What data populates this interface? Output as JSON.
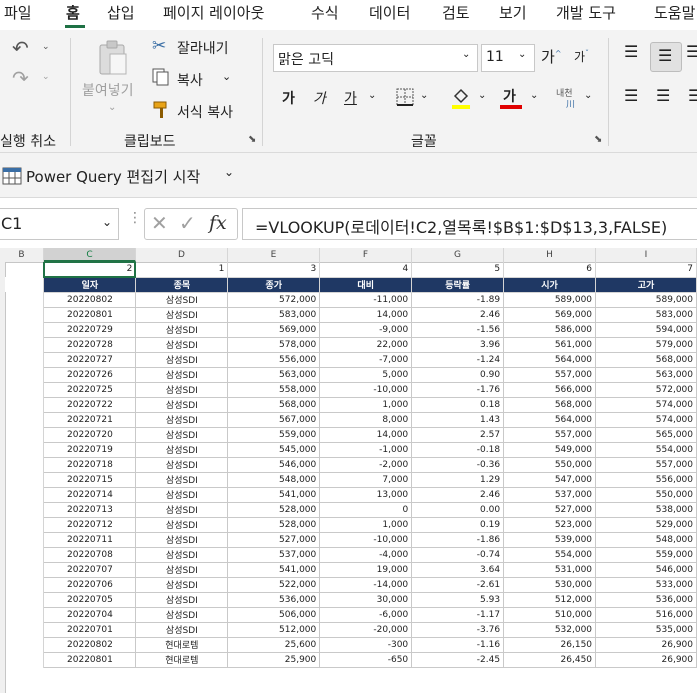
{
  "menu": [
    "파일",
    "홈",
    "삽입",
    "페이지 레이아웃",
    "수식",
    "데이터",
    "검토",
    "보기",
    "개발 도구",
    "도움말"
  ],
  "ribbon": {
    "undo_label": "실행 취소",
    "paste_label": "붙여넣기",
    "cut_label": "잘라내기",
    "copy_label": "복사",
    "format_painter_label": "서식 복사",
    "clipboard_label": "클립보드",
    "font_name": "맑은 고딕",
    "font_size": "11",
    "bold": "가",
    "italic": "가",
    "underline": "가",
    "font_color_glyph": "가",
    "phonetic": "내천",
    "font_label": "글꼴",
    "font_color": "#e00000",
    "fill_color": "#ffff00"
  },
  "querybar": {
    "label": "Power Query 편집기 시작"
  },
  "formulabar": {
    "namebox": "C1",
    "fx": "fx",
    "formula": "=VLOOKUP(로데이터!C2,열목록!$B$1:$D$13,3,FALSE)"
  },
  "sheet": {
    "columns": [
      "B",
      "C",
      "D",
      "E",
      "F",
      "G",
      "H",
      "I"
    ],
    "selected_column": "C",
    "row1": [
      "",
      "2",
      "1",
      "3",
      "4",
      "5",
      "6",
      "7"
    ],
    "headers": [
      "일자",
      "종목",
      "종가",
      "대비",
      "등락률",
      "시가",
      "고가"
    ],
    "rows": [
      [
        "20220802",
        "삼성SDI",
        "572,000",
        "-11,000",
        "-1.89",
        "589,000",
        "589,000"
      ],
      [
        "20220801",
        "삼성SDI",
        "583,000",
        "14,000",
        "2.46",
        "569,000",
        "583,000"
      ],
      [
        "20220729",
        "삼성SDI",
        "569,000",
        "-9,000",
        "-1.56",
        "586,000",
        "594,000"
      ],
      [
        "20220728",
        "삼성SDI",
        "578,000",
        "22,000",
        "3.96",
        "561,000",
        "579,000"
      ],
      [
        "20220727",
        "삼성SDI",
        "556,000",
        "-7,000",
        "-1.24",
        "564,000",
        "568,000"
      ],
      [
        "20220726",
        "삼성SDI",
        "563,000",
        "5,000",
        "0.90",
        "557,000",
        "563,000"
      ],
      [
        "20220725",
        "삼성SDI",
        "558,000",
        "-10,000",
        "-1.76",
        "566,000",
        "572,000"
      ],
      [
        "20220722",
        "삼성SDI",
        "568,000",
        "1,000",
        "0.18",
        "568,000",
        "574,000"
      ],
      [
        "20220721",
        "삼성SDI",
        "567,000",
        "8,000",
        "1.43",
        "564,000",
        "574,000"
      ],
      [
        "20220720",
        "삼성SDI",
        "559,000",
        "14,000",
        "2.57",
        "557,000",
        "565,000"
      ],
      [
        "20220719",
        "삼성SDI",
        "545,000",
        "-1,000",
        "-0.18",
        "549,000",
        "554,000"
      ],
      [
        "20220718",
        "삼성SDI",
        "546,000",
        "-2,000",
        "-0.36",
        "550,000",
        "557,000"
      ],
      [
        "20220715",
        "삼성SDI",
        "548,000",
        "7,000",
        "1.29",
        "547,000",
        "556,000"
      ],
      [
        "20220714",
        "삼성SDI",
        "541,000",
        "13,000",
        "2.46",
        "537,000",
        "550,000"
      ],
      [
        "20220713",
        "삼성SDI",
        "528,000",
        "0",
        "0.00",
        "527,000",
        "538,000"
      ],
      [
        "20220712",
        "삼성SDI",
        "528,000",
        "1,000",
        "0.19",
        "523,000",
        "529,000"
      ],
      [
        "20220711",
        "삼성SDI",
        "527,000",
        "-10,000",
        "-1.86",
        "539,000",
        "548,000"
      ],
      [
        "20220708",
        "삼성SDI",
        "537,000",
        "-4,000",
        "-0.74",
        "554,000",
        "559,000"
      ],
      [
        "20220707",
        "삼성SDI",
        "541,000",
        "19,000",
        "3.64",
        "531,000",
        "546,000"
      ],
      [
        "20220706",
        "삼성SDI",
        "522,000",
        "-14,000",
        "-2.61",
        "530,000",
        "533,000"
      ],
      [
        "20220705",
        "삼성SDI",
        "536,000",
        "30,000",
        "5.93",
        "512,000",
        "536,000"
      ],
      [
        "20220704",
        "삼성SDI",
        "506,000",
        "-6,000",
        "-1.17",
        "510,000",
        "516,000"
      ],
      [
        "20220701",
        "삼성SDI",
        "512,000",
        "-20,000",
        "-3.76",
        "532,000",
        "535,000"
      ],
      [
        "20220802",
        "현대로템",
        "25,600",
        "-300",
        "-1.16",
        "26,150",
        "26,900"
      ],
      [
        "20220801",
        "현대로템",
        "25,900",
        "-650",
        "-2.45",
        "26,450",
        "26,900"
      ]
    ]
  }
}
